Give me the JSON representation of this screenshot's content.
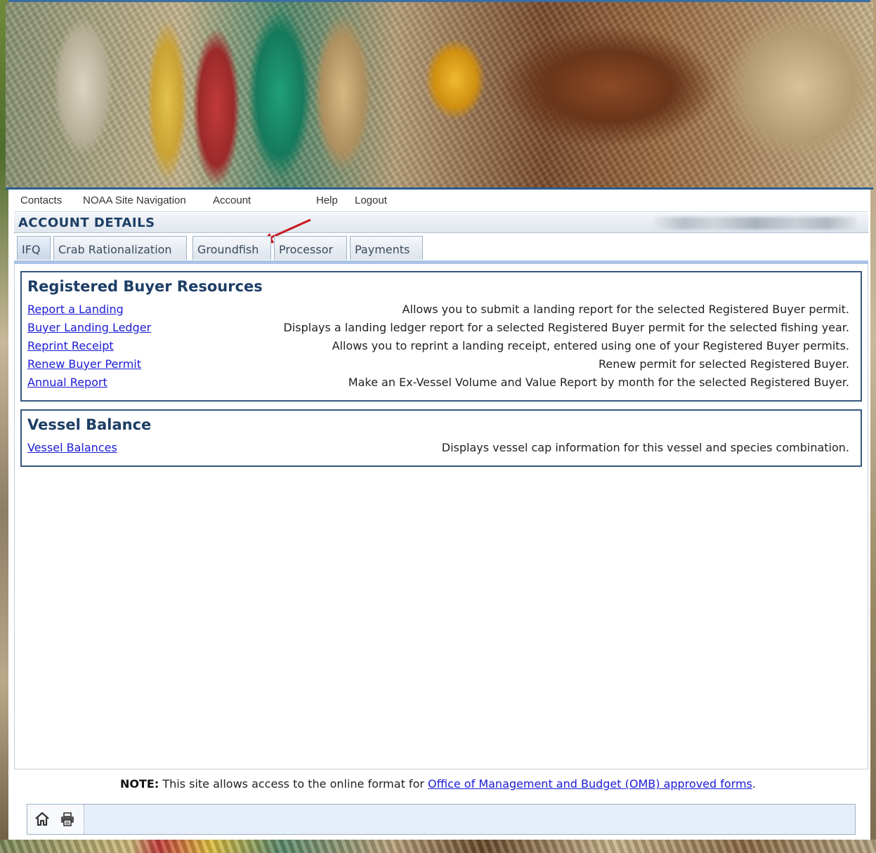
{
  "nav": {
    "items": [
      "Contacts",
      "NOAA Site Navigation",
      "Account",
      "Help",
      "Logout"
    ]
  },
  "header": {
    "title": "ACCOUNT DETAILS"
  },
  "tabs": [
    {
      "label": "IFQ",
      "active": true
    },
    {
      "label": "Crab Rationalization",
      "active": false
    },
    {
      "label": "Groundfish",
      "active": false
    },
    {
      "label": "Processor",
      "active": false
    },
    {
      "label": "Payments",
      "active": false
    }
  ],
  "sections": [
    {
      "title": "Registered Buyer Resources",
      "rows": [
        {
          "link": "Report a Landing",
          "desc": "Allows you to submit a landing report for the selected Registered Buyer permit."
        },
        {
          "link": "Buyer Landing Ledger",
          "desc": "Displays a landing ledger report for a selected Registered Buyer permit for the selected fishing year."
        },
        {
          "link": "Reprint Receipt",
          "desc": "Allows you to reprint a landing receipt, entered using one of your Registered Buyer permits."
        },
        {
          "link": "Renew Buyer Permit",
          "desc": "Renew permit for selected Registered Buyer."
        },
        {
          "link": "Annual Report",
          "desc": "Make an Ex-Vessel Volume and Value Report by month for the selected Registered Buyer."
        }
      ]
    },
    {
      "title": "Vessel Balance",
      "rows": [
        {
          "link": "Vessel Balances",
          "desc": "Displays vessel cap information for this vessel and species combination."
        }
      ]
    }
  ],
  "footer": {
    "note_label": "NOTE:",
    "note_text": " This site allows access to the online format for ",
    "note_link": "Office of Management and Budget (OMB) approved forms",
    "note_end": "."
  },
  "colors": {
    "title_blue": "#1d3e66",
    "link_blue": "#1b1bd6",
    "panel_border": "#34577e",
    "tab_underline": "#aac3e6"
  },
  "icons": [
    "home-icon",
    "print-icon"
  ]
}
